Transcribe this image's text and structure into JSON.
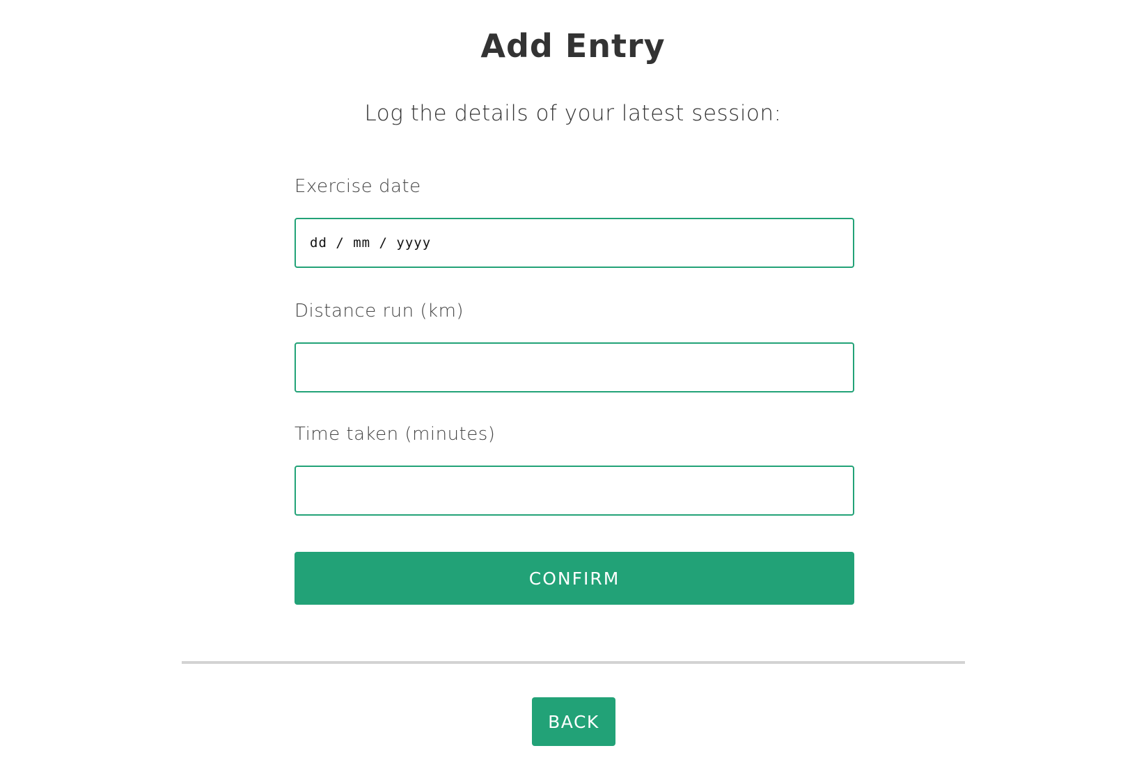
{
  "header": {
    "title": "Add Entry",
    "subtitle": "Log the details of your latest session:"
  },
  "form": {
    "date": {
      "label": "Exercise date",
      "placeholder": "dd / mm / yyyy",
      "value": ""
    },
    "distance": {
      "label": "Distance run (km)",
      "placeholder": "",
      "value": ""
    },
    "time": {
      "label": "Time taken (minutes)",
      "placeholder": "",
      "value": ""
    },
    "confirm_label": "CONFIRM"
  },
  "footer": {
    "back_label": "BACK"
  },
  "colors": {
    "accent": "#22a277",
    "divider": "#d3d3d3",
    "text": "#333333"
  }
}
